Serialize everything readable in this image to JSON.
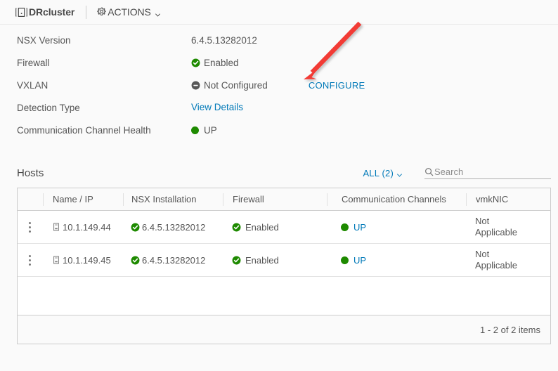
{
  "header": {
    "object_name": "DRcluster",
    "object_icon": "cluster-icon",
    "actions_label": "ACTIONS",
    "actions_icon": "gear-icon",
    "dropdown_icon": "chevron-down-icon"
  },
  "details": [
    {
      "label": "NSX Version",
      "value": "6.4.5.13282012",
      "status_icon": "none",
      "link": null
    },
    {
      "label": "Firewall",
      "value": "Enabled",
      "status_icon": "check-circle-green",
      "link": null
    },
    {
      "label": "VXLAN",
      "value": "Not Configured",
      "status_icon": "minus-circle-grey",
      "link": "CONFIGURE"
    },
    {
      "label": "Detection Type",
      "value": "View Details",
      "status_icon": "none",
      "link": null
    },
    {
      "label": "Communication Channel Health",
      "value": "UP",
      "status_icon": "dot-green",
      "link": null
    }
  ],
  "hosts": {
    "title": "Hosts",
    "filter_label": "ALL (2)",
    "search_placeholder": "Search",
    "search_value": "",
    "search_icon": "search-icon",
    "columns": [
      "",
      "Name / IP",
      "NSX Installation",
      "Firewall",
      "Communication Channels",
      "vmkNIC"
    ],
    "rows": [
      {
        "menu_icon": "kebab-menu-icon",
        "name": "10.1.149.44",
        "name_icon": "host-icon",
        "nsx_installation": "6.4.5.13282012",
        "nsx_icon": "check-circle-green",
        "firewall": "Enabled",
        "firewall_icon": "check-circle-green",
        "communication_channels": "UP",
        "cc_icon": "dot-green",
        "vmknic": "Not Applicable"
      },
      {
        "menu_icon": "kebab-menu-icon",
        "name": "10.1.149.45",
        "name_icon": "host-icon",
        "nsx_installation": "6.4.5.13282012",
        "nsx_icon": "check-circle-green",
        "firewall": "Enabled",
        "firewall_icon": "check-circle-green",
        "communication_channels": "UP",
        "cc_icon": "dot-green",
        "vmknic": "Not Applicable"
      }
    ],
    "footer_text": "1 - 2 of 2 items"
  },
  "annotation": {
    "type": "arrow",
    "color": "#f23b35",
    "points_to": "CONFIGURE"
  },
  "colors": {
    "link": "#0079b8",
    "status_green": "#1e8a00",
    "status_grey": "#565656",
    "annotation_red": "#f23b35"
  }
}
